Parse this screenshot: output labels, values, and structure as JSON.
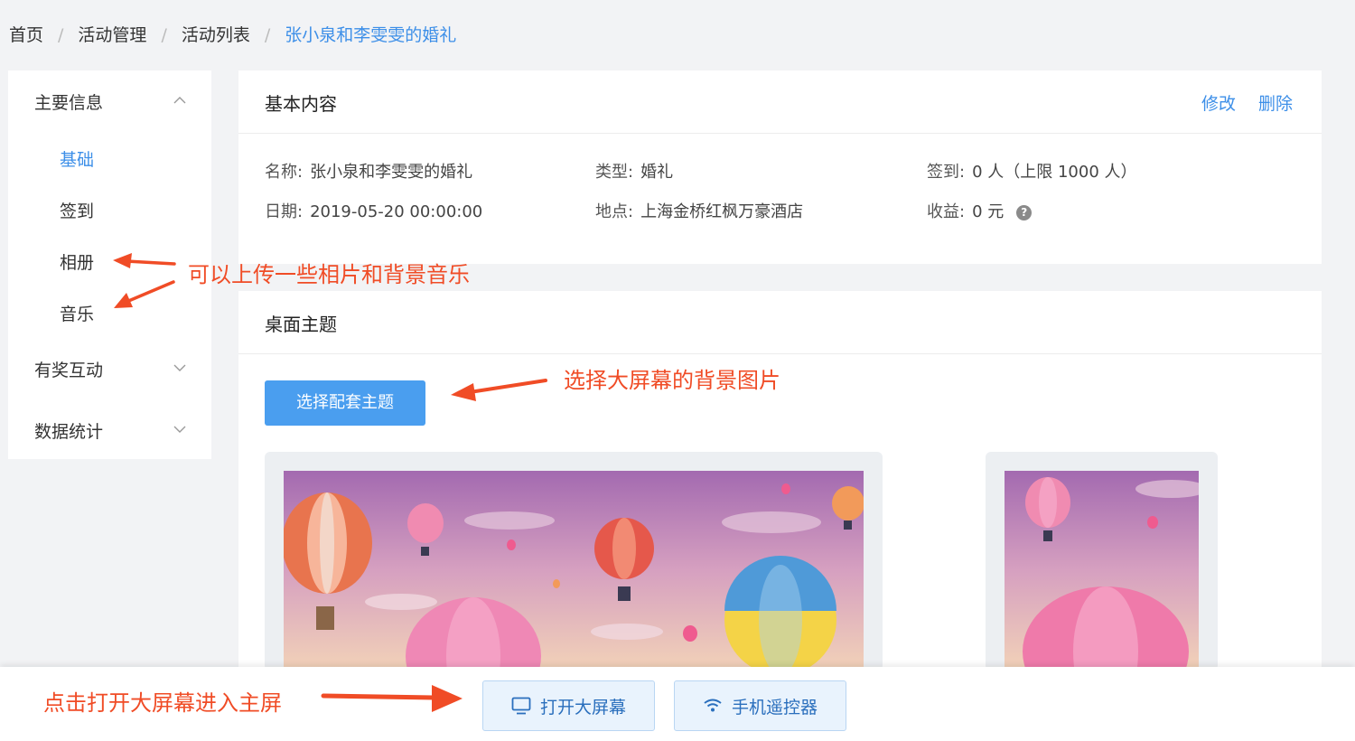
{
  "breadcrumb": {
    "items": [
      "首页",
      "活动管理",
      "活动列表"
    ],
    "current": "张小泉和李雯雯的婚礼"
  },
  "sidebar": {
    "group_main": "主要信息",
    "sub_items": [
      "基础",
      "签到",
      "相册",
      "音乐"
    ],
    "group_interaction": "有奖互动",
    "group_stats": "数据统计"
  },
  "basic": {
    "title": "基本内容",
    "edit_label": "修改",
    "delete_label": "删除",
    "fields": {
      "name_label": "名称:",
      "name_value": "张小泉和李雯雯的婚礼",
      "type_label": "类型:",
      "type_value": "婚礼",
      "checkin_label": "签到:",
      "checkin_value": "0 人（上限 1000 人）",
      "date_label": "日期:",
      "date_value": "2019-05-20 00:00:00",
      "place_label": "地点:",
      "place_value": "上海金桥红枫万豪酒店",
      "income_label": "收益:",
      "income_value": "0 元"
    }
  },
  "theme": {
    "title": "桌面主题",
    "select_button": "选择配套主题"
  },
  "bottom": {
    "open_screen": "打开大屏幕",
    "remote": "手机遥控器"
  },
  "annotations": {
    "upload_note": "可以上传一些相片和背景音乐",
    "theme_note": "选择大屏幕的背景图片",
    "open_note": "点击打开大屏幕进入主屏"
  },
  "colors": {
    "accent": "#3d8fe8",
    "annotation": "#f04c26"
  }
}
